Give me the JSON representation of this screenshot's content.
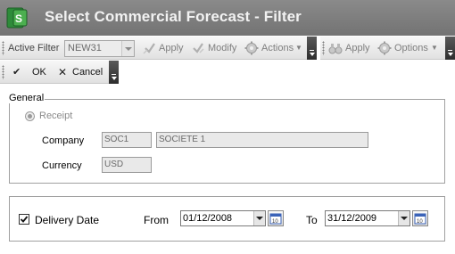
{
  "window": {
    "title": "Select Commercial Forecast - Filter"
  },
  "toolbar1": {
    "active_filter_label": "Active Filter",
    "active_filter_value": "NEW31",
    "apply_label": "Apply",
    "modify_label": "Modify",
    "actions_label": "Actions"
  },
  "toolbar2": {
    "apply_label": "Apply",
    "options_label": "Options"
  },
  "toolbar3": {
    "ok_label": "OK",
    "cancel_label": "Cancel"
  },
  "general": {
    "legend": "General",
    "receipt_label": "Receipt",
    "company_label": "Company",
    "company_code": "SOC1",
    "company_name": "SOCIETE 1",
    "currency_label": "Currency",
    "currency_value": "USD"
  },
  "delivery": {
    "checked": true,
    "label": "Delivery Date",
    "from_label": "From",
    "from_value": "01/12/2008",
    "to_label": "To",
    "to_value": "31/12/2009"
  }
}
